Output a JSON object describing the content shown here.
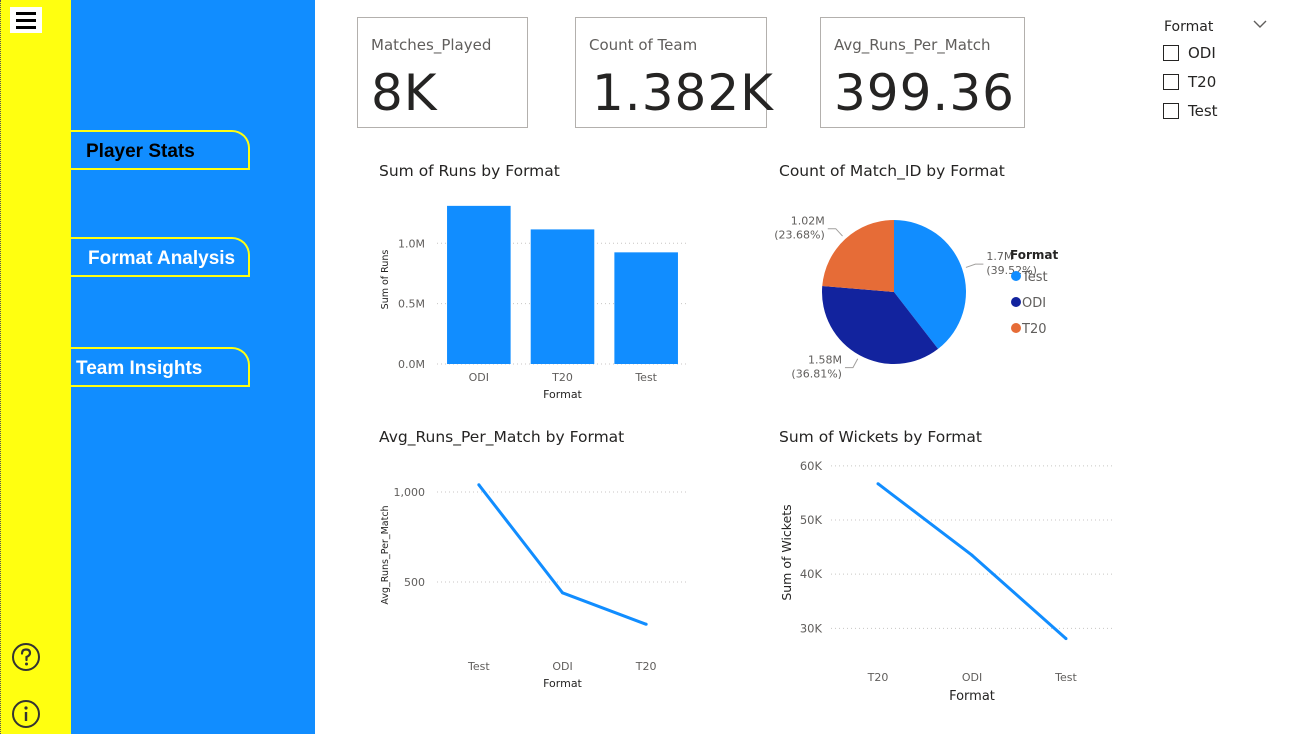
{
  "nav": {
    "player_stats": "Player Stats",
    "format_analysis": "Format Analysis",
    "team_insights": "Team Insights"
  },
  "cards": [
    {
      "label": "Matches_Played",
      "value": "8K"
    },
    {
      "label": "Count of Team",
      "value": "1.382K"
    },
    {
      "label": "Avg_Runs_Per_Match",
      "value": "399.36"
    }
  ],
  "slicer": {
    "title": "Format",
    "options": [
      "ODI",
      "T20",
      "Test"
    ]
  },
  "icons": {
    "menu": "hamburger-menu-icon",
    "help": "help-icon",
    "info": "info-icon",
    "chevron": "chevron-down-icon"
  },
  "colors": {
    "rail": "#ffff10",
    "nav": "#118dff",
    "series": "#118dff",
    "odi": "#12239e",
    "t20": "#e66c37"
  },
  "chart_data": [
    {
      "type": "bar",
      "title": "Sum of Runs by Format",
      "xlabel": "Format",
      "ylabel": "Sum of Runs",
      "categories": [
        "ODI",
        "T20",
        "Test"
      ],
      "values": [
        1310000,
        1115000,
        925000
      ],
      "yticks": [
        "0.0M",
        "0.5M",
        "1.0M"
      ],
      "ylim": [
        0,
        1400000
      ],
      "grid": true
    },
    {
      "type": "pie",
      "title": "Count of Match_ID by Format",
      "legend_title": "Format",
      "legend_position": "right",
      "slices": [
        {
          "name": "Test",
          "value": 39.52,
          "label": "1.7M",
          "pct": "(39.52%)",
          "color": "#118dff"
        },
        {
          "name": "ODI",
          "value": 36.81,
          "label": "1.58M",
          "pct": "(36.81%)",
          "color": "#12239e"
        },
        {
          "name": "T20",
          "value": 23.68,
          "label": "1.02M",
          "pct": "(23.68%)",
          "color": "#e66c37"
        }
      ]
    },
    {
      "type": "line",
      "title": "Avg_Runs_Per_Match by Format",
      "xlabel": "Format",
      "ylabel": "Avg_Runs_Per_Match",
      "categories": [
        "Test",
        "ODI",
        "T20"
      ],
      "values": [
        1040,
        440,
        265
      ],
      "yticks": [
        "500",
        "1,000"
      ],
      "ylim": [
        150,
        1150
      ],
      "grid": true
    },
    {
      "type": "line",
      "title": "Sum of Wickets by Format",
      "xlabel": "Format",
      "ylabel": "Sum of Wickets",
      "categories": [
        "T20",
        "ODI",
        "Test"
      ],
      "values": [
        56700,
        43500,
        28100
      ],
      "yticks": [
        "30K",
        "40K",
        "50K",
        "60K"
      ],
      "ylim": [
        26000,
        62000
      ],
      "grid": true
    }
  ]
}
